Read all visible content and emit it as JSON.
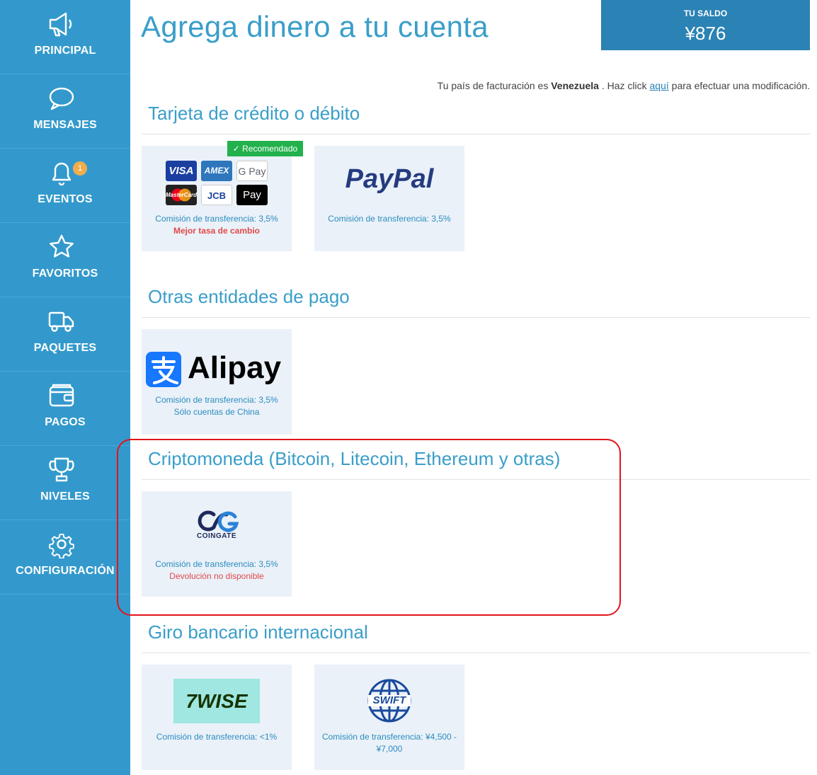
{
  "sidebar": {
    "items": [
      {
        "label": "PRINCIPAL",
        "icon": "megaphone-icon"
      },
      {
        "label": "MENSAJES",
        "icon": "chat-bubble-icon"
      },
      {
        "label": "EVENTOS",
        "icon": "bell-icon",
        "badge": "1"
      },
      {
        "label": "FAVORITOS",
        "icon": "star-icon"
      },
      {
        "label": "PAQUETES",
        "icon": "truck-icon"
      },
      {
        "label": "PAGOS",
        "icon": "wallet-icon"
      },
      {
        "label": "NIVELES",
        "icon": "trophy-icon"
      },
      {
        "label": "CONFIGURACIÓN",
        "icon": "gear-icon"
      }
    ]
  },
  "header": {
    "title": "Agrega dinero a tu cuenta",
    "balance_label": "TU SALDO",
    "balance_value": "¥876"
  },
  "billing": {
    "prefix": "Tu país de facturación es",
    "country": "Venezuela",
    "middle": ". Haz click",
    "link": "aquí",
    "suffix": "para efectuar una modificación."
  },
  "sections": [
    {
      "title": "Tarjeta de crédito o débito",
      "cards": [
        {
          "logo": "card-brands",
          "brands": [
            "VISA",
            "AMEX",
            "G Pay",
            "MasterCard",
            "JCB",
            " Pay"
          ],
          "fee": "Comisión de transferencia:  3,5%",
          "note": "Mejor tasa de cambio",
          "tag": "✓ Recomendado"
        },
        {
          "logo": "PayPal",
          "fee": "Comisión de transferencia:  3,5%"
        }
      ]
    },
    {
      "title": "Otras entidades de pago",
      "cards": [
        {
          "logo": "Alipay",
          "fee": "Comisión de transferencia:  3,5%",
          "note": "Sólo cuentas de China"
        }
      ]
    },
    {
      "title": "Criptomoneda (Bitcoin, Litecoin, Ethereum y otras)",
      "cards": [
        {
          "logo": "COINGATE",
          "fee": "Comisión de transferencia:  3,5%",
          "note": "Devolución no disponible"
        }
      ]
    },
    {
      "title": "Giro bancario internacional",
      "cards": [
        {
          "logo": "WISE",
          "fee": "Comisión de transferencia:  <1%"
        },
        {
          "logo": "SWIFT",
          "fee": "Comisión de transferencia:  ¥4,500 -",
          "fee2": "¥7,000"
        }
      ]
    }
  ],
  "colors": {
    "sidebar": "#3399cc",
    "accent": "#3a9ec9",
    "balance_bg": "#2b82b4",
    "highlight": "#e1141c",
    "recommended": "#22b14c"
  }
}
